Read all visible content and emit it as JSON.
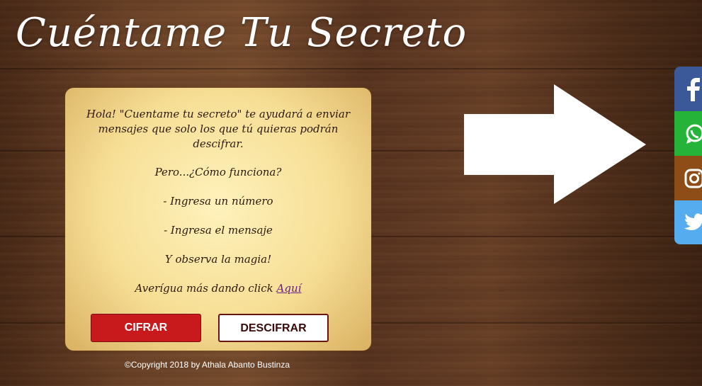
{
  "header": {
    "title": "Cuéntame Tu Secreto"
  },
  "card": {
    "intro": "Hola! \"Cuentame tu secreto\" te ayudará a enviar mensajes que solo los que tú quieras podrán descifrar.",
    "question": "Pero...¿Cómo funciona?",
    "step1": "- Ingresa un número",
    "step2": "- Ingresa el mensaje",
    "outcome": "Y observa la magia!",
    "more_prefix": "Averígua más dando click ",
    "more_link": "Aquí"
  },
  "buttons": {
    "encrypt": "CIFRAR",
    "decrypt": "DESCIFRAR"
  },
  "footer": {
    "copyright": "©Copyright 2018 by Athala Abanto Bustinza"
  },
  "social": {
    "items": [
      {
        "name": "facebook-icon",
        "color": "#3b5998"
      },
      {
        "name": "whatsapp-icon",
        "color": "#25b33a"
      },
      {
        "name": "instagram-icon",
        "color": "#8e4d16"
      },
      {
        "name": "twitter-icon",
        "color": "#55acee"
      }
    ]
  },
  "colors": {
    "encrypt_button": "#c8191d",
    "decrypt_border": "#6b1414",
    "link": "#6a1e8a"
  }
}
